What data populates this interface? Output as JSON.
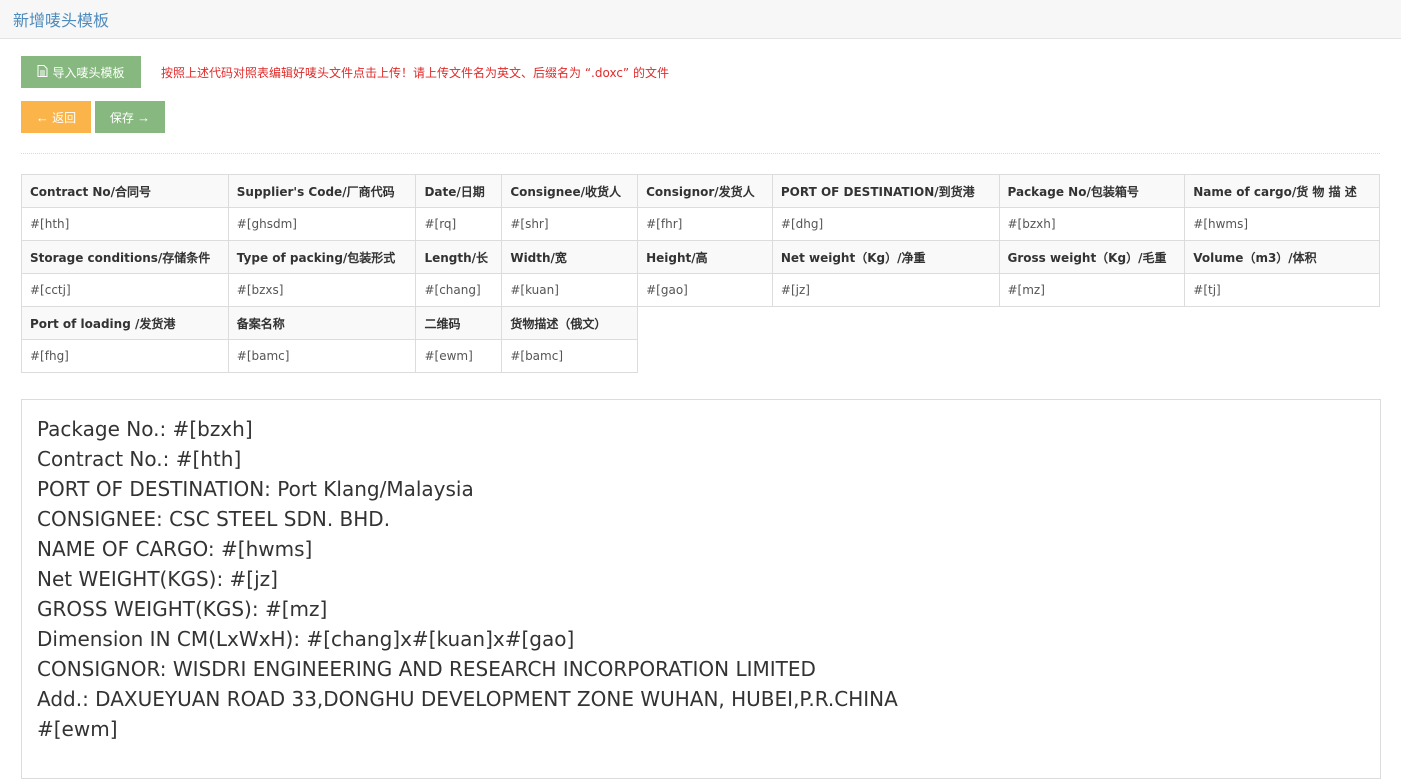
{
  "page": {
    "title": "新增唛头模板"
  },
  "toolbar": {
    "import_label": "导入唛头模板",
    "hint": "按照上述代码对照表编辑好唛头文件点击上传！请上传文件名为英文、后缀名为 “.doxc” 的文件",
    "back_label": "返回",
    "save_label": "保存",
    "colors": {
      "import": "#87b87f",
      "back": "#fbb44a",
      "save": "#87b87f",
      "hint": "#e02b2b"
    }
  },
  "code_table": {
    "rows": [
      {
        "labels": [
          "Contract No/合同号",
          "Supplier's Code/厂商代码",
          "Date/日期",
          "Consignee/收货人",
          "Consignor/发货人",
          "PORT OF DESTINATION/到货港",
          "Package No/包装箱号",
          "Name of cargo/货 物 描 述"
        ],
        "codes": [
          "#[hth]",
          "#[ghsdm]",
          "#[rq]",
          "#[shr]",
          "#[fhr]",
          "#[dhg]",
          "#[bzxh]",
          "#[hwms]"
        ]
      },
      {
        "labels": [
          "Storage conditions/存储条件",
          "Type of packing/包装形式",
          "Length/长",
          "Width/宽",
          "Height/高",
          "Net weight（Kg）/净重",
          "Gross weight（Kg）/毛重",
          "Volume（m3）/体积"
        ],
        "codes": [
          "#[cctj]",
          "#[bzxs]",
          "#[chang]",
          "#[kuan]",
          "#[gao]",
          "#[jz]",
          "#[mz]",
          "#[tj]"
        ]
      },
      {
        "labels": [
          "Port of loading /发货港",
          "备案名称",
          "二维码",
          "货物描述（俄文）"
        ],
        "codes": [
          "#[fhg]",
          "#[bamc]",
          "#[ewm]",
          "#[bamc]"
        ]
      }
    ]
  },
  "preview": {
    "lines": [
      "Package No.: #[bzxh]",
      "Contract No.: #[hth]",
      "PORT OF DESTINATION: Port Klang/Malaysia",
      "CONSIGNEE: CSC STEEL SDN. BHD.",
      "NAME OF CARGO: #[hwms]",
      "Net WEIGHT(KGS): #[jz]",
      "GROSS WEIGHT(KGS): #[mz]",
      "Dimension IN CM(LxWxH): #[chang]x#[kuan]x#[gao]",
      "CONSIGNOR: WISDRI ENGINEERING AND RESEARCH INCORPORATION LIMITED",
      "Add.: DAXUEYUAN ROAD 33,DONGHU DEVELOPMENT ZONE WUHAN, HUBEI,P.R.CHINA",
      "#[ewm]"
    ]
  }
}
